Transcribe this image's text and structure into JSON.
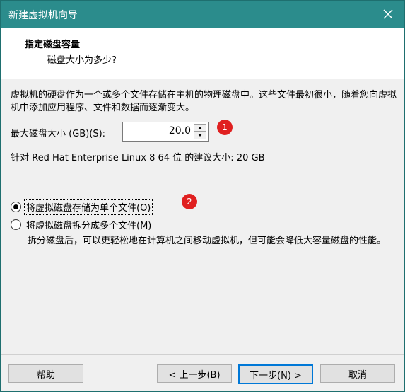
{
  "window": {
    "title": "新建虚拟机向导"
  },
  "header": {
    "title": "指定磁盘容量",
    "subtitle": "磁盘大小为多少?"
  },
  "description": "虚拟机的硬盘作为一个或多个文件存储在主机的物理磁盘中。这些文件最初很小，随着您向虚拟机中添加应用程序、文件和数据而逐渐变大。",
  "disk_size": {
    "label": "最大磁盘大小 (GB)(S):",
    "value": "20.0"
  },
  "recommendation": "针对 Red Hat Enterprise Linux 8 64 位 的建议大小: 20 GB",
  "options": {
    "single_file": {
      "label": "将虚拟磁盘存储为单个文件(O)",
      "selected": true
    },
    "multiple_files": {
      "label": "将虚拟磁盘拆分成多个文件(M)",
      "selected": false
    }
  },
  "split_description": "拆分磁盘后，可以更轻松地在计算机之间移动虚拟机，但可能会降低大容量磁盘的性能。",
  "annotations": {
    "badge1": "1",
    "badge2": "2"
  },
  "buttons": {
    "help": "帮助",
    "back": "< 上一步(B)",
    "next": "下一步(N) >",
    "cancel": "取消"
  },
  "colors": {
    "titlebar": "#2b8c8c",
    "badge": "#e02020",
    "focus": "#0078d7"
  }
}
